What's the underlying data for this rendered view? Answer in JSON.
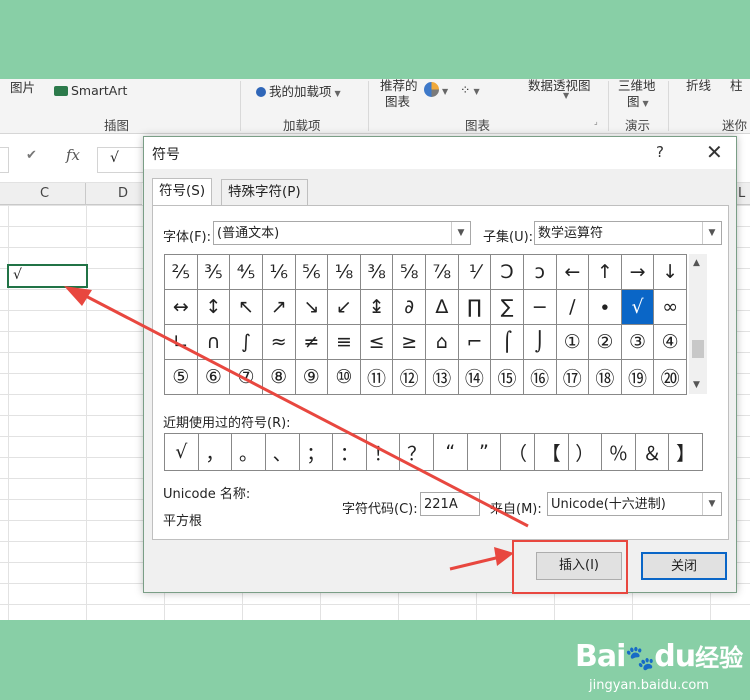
{
  "ribbon": {
    "items": {
      "picture_partial": "图片",
      "smartart": "SmartArt",
      "my_addins": "我的加载项",
      "recommended_charts_1": "推荐的",
      "recommended_charts_2": "图表",
      "pivot_chart": "数据透视图",
      "map_3d_1": "三维地",
      "map_3d_2": "图",
      "line_spark": "折线",
      "column_spark_partial": "柱"
    },
    "groups": {
      "illustrations": "插图",
      "addins": "加载项",
      "charts": "图表",
      "tours": "演示",
      "sparklines_partial": "迷你"
    }
  },
  "formula_bar": {
    "cancel": "✕",
    "enter": "✔",
    "fx": "fx",
    "content": "√"
  },
  "columns": [
    "C",
    "D",
    "L"
  ],
  "cell": {
    "value": "√"
  },
  "dialog": {
    "title": "符号",
    "help": "?",
    "close": "✕",
    "tabs": [
      "符号(S)",
      "特殊字符(P)"
    ],
    "font_label": "字体(F):",
    "font_value": "(普通文本)",
    "subset_label": "子集(U):",
    "subset_value": "数学运算符",
    "symbols": [
      [
        "⅖",
        "⅗",
        "⅘",
        "⅙",
        "⅚",
        "⅛",
        "⅜",
        "⅝",
        "⅞",
        "⅟",
        "Ↄ",
        "ↄ",
        "←",
        "↑",
        "→",
        "↓"
      ],
      [
        "↔",
        "↕",
        "↖",
        "↗",
        "↘",
        "↙",
        "↨",
        "∂",
        "∆",
        "∏",
        "∑",
        "−",
        "∕",
        "∙",
        "√",
        "∞"
      ],
      [
        "∟",
        "∩",
        "∫",
        "≈",
        "≠",
        "≡",
        "≤",
        "≥",
        "⌂",
        "⌐",
        "⌠",
        "⌡",
        "①",
        "②",
        "③",
        "④"
      ],
      [
        "⑤",
        "⑥",
        "⑦",
        "⑧",
        "⑨",
        "⑩",
        "⑪",
        "⑫",
        "⑬",
        "⑭",
        "⑮",
        "⑯",
        "⑰",
        "⑱",
        "⑲",
        "⑳"
      ]
    ],
    "selected_symbol": "√",
    "recent_label": "近期使用过的符号(R):",
    "recent_symbols": [
      "√",
      "，",
      "。",
      "、",
      "；",
      "：",
      "！",
      "？",
      "“",
      "”",
      "（",
      "【",
      "）",
      "％",
      "＆",
      "】"
    ],
    "unicode_name_label": "Unicode 名称:",
    "unicode_name_value": "平方根",
    "char_code_label": "字符代码(C):",
    "char_code_value": "221A",
    "from_label": "来自(M):",
    "from_value": "Unicode(十六进制)",
    "insert_button": "插入(I)",
    "close_button": "关闭"
  },
  "watermark": {
    "brand_a": "Bai",
    "brand_b": "du",
    "brand_cn": "经验",
    "url": "jingyan.baidu.com"
  },
  "colors": {
    "band": "#88cfa6",
    "selection_blue": "#0a66c7",
    "annotation_red": "#e8473f",
    "excel_green": "#217346"
  }
}
